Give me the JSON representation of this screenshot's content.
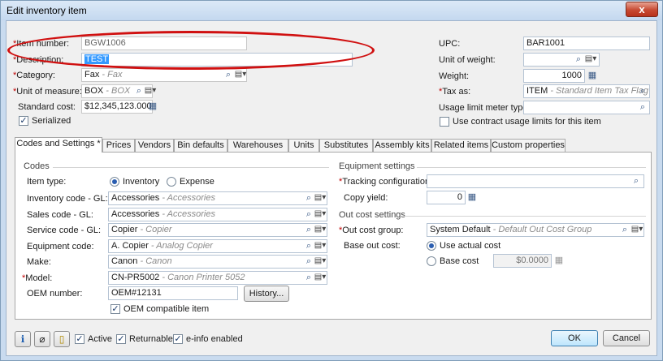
{
  "window": {
    "title": "Edit inventory item",
    "close": "x"
  },
  "left": {
    "item_number": {
      "label": "*Item number:",
      "value": "BGW1006"
    },
    "description": {
      "label": "*Description:",
      "value": "TEST"
    },
    "category": {
      "label": "*Category:",
      "value": "Fax",
      "desc": " - Fax"
    },
    "unit_of_measure": {
      "label": "*Unit of measure:",
      "value": "BOX",
      "desc": " - BOX"
    },
    "standard_cost": {
      "label": "Standard cost:",
      "value": "$12,345,123.0000"
    },
    "serialized": {
      "label": "Serialized",
      "checked": true
    }
  },
  "right": {
    "upc": {
      "label": "UPC:",
      "value": "BAR1001"
    },
    "unit_of_weight": {
      "label": "Unit of weight:",
      "value": ""
    },
    "weight": {
      "label": "Weight:",
      "value": "1000"
    },
    "tax_as": {
      "label": "*Tax as:",
      "value": "ITEM",
      "desc": " - Standard Item Tax Flag"
    },
    "usage_limit": {
      "label": "Usage limit meter type:",
      "value": ""
    },
    "contract_usage": {
      "label": "Use contract usage limits for this item",
      "checked": false
    }
  },
  "tabs": [
    "Codes and Settings *",
    "Prices",
    "Vendors",
    "Bin defaults",
    "Warehouses",
    "Units",
    "Substitutes",
    "Assembly kits",
    "Related items",
    "Custom properties"
  ],
  "codes": {
    "section": "Codes",
    "item_type": {
      "label": "Item type:",
      "option1": "Inventory",
      "option2": "Expense",
      "selected": "Inventory"
    },
    "inventory_gl": {
      "label": "Inventory code - GL:",
      "value": "Accessories",
      "desc": " - Accessories"
    },
    "sales_gl": {
      "label": "Sales code - GL:",
      "value": "Accessories",
      "desc": " - Accessories"
    },
    "service_gl": {
      "label": "Service code - GL:",
      "value": "Copier",
      "desc": " - Copier"
    },
    "equipment_code": {
      "label": "Equipment code:",
      "value": "A. Copier",
      "desc": " - Analog Copier"
    },
    "make": {
      "label": "Make:",
      "value": "Canon",
      "desc": " - Canon"
    },
    "model": {
      "label": "*Model:",
      "value": "CN-PR5002",
      "desc": " - Canon Printer 5052"
    },
    "oem_number": {
      "label": "OEM number:",
      "value": "OEM#12131"
    },
    "history_button": "History...",
    "oem_compatible": {
      "label": "OEM compatible item",
      "checked": true
    }
  },
  "equipment": {
    "section": "Equipment settings",
    "tracking": {
      "label": "*Tracking configuration:",
      "value": ""
    },
    "copy_yield": {
      "label": "Copy yield:",
      "value": "0"
    }
  },
  "outcost": {
    "section": "Out cost settings",
    "group": {
      "label": "*Out cost group:",
      "value": "System Default",
      "desc": " - Default Out Cost Group"
    },
    "base_label": "Base out cost:",
    "use_actual": "Use actual cost",
    "base_cost": "Base cost",
    "base_cost_value": "$0.0000",
    "selected": "Use actual cost"
  },
  "footer": {
    "active": {
      "label": "Active",
      "checked": true
    },
    "returnable": {
      "label": "Returnable",
      "checked": true
    },
    "einfo": {
      "label": "e-info enabled",
      "checked": true
    },
    "ok": "OK",
    "cancel": "Cancel"
  },
  "colors": {
    "accent": "#3399ff",
    "required": "#c00000",
    "annotation": "#d01010"
  },
  "icons": [
    "search-icon",
    "dropdown-icon",
    "calculator-icon",
    "info-icon",
    "attach-icon",
    "note-icon"
  ]
}
